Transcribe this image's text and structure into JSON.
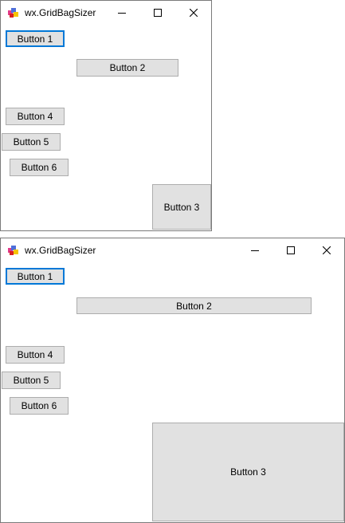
{
  "windows": [
    {
      "title": "wx.GridBagSizer",
      "buttons": {
        "b1": "Button 1",
        "b2": "Button 2",
        "b3": "Button 3",
        "b4": "Button 4",
        "b5": "Button 5",
        "b6": "Button 6"
      }
    },
    {
      "title": "wx.GridBagSizer",
      "buttons": {
        "b1": "Button 1",
        "b2": "Button 2",
        "b3": "Button 3",
        "b4": "Button 4",
        "b5": "Button 5",
        "b6": "Button 6"
      }
    }
  ],
  "icons": {
    "app": "app-icon",
    "minimize": "minimize-icon",
    "maximize": "maximize-icon",
    "close": "close-icon"
  },
  "colors": {
    "focus_border": "#0078d7",
    "button_face": "#e1e1e1",
    "button_border": "#adadad",
    "window_border": "#7a7a7a"
  }
}
